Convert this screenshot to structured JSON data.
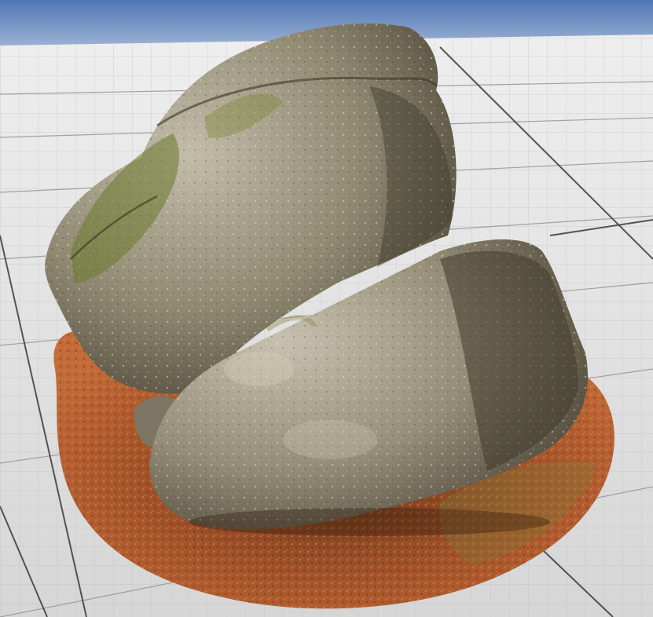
{
  "scene": {
    "sky_color": "#5b82bd",
    "horizon_color": "#9fb4d3",
    "floor_tile_color": "#d9d9d9",
    "floor_grid_color": "#b8b8b8",
    "floor_major_grid_color": "#3a3a3a",
    "soil_color": "#a5532a",
    "rock_light": "#b9b3a2",
    "rock_mid": "#8e8672",
    "rock_dark": "#4a4436",
    "moss_color": "#6f7a2e"
  }
}
